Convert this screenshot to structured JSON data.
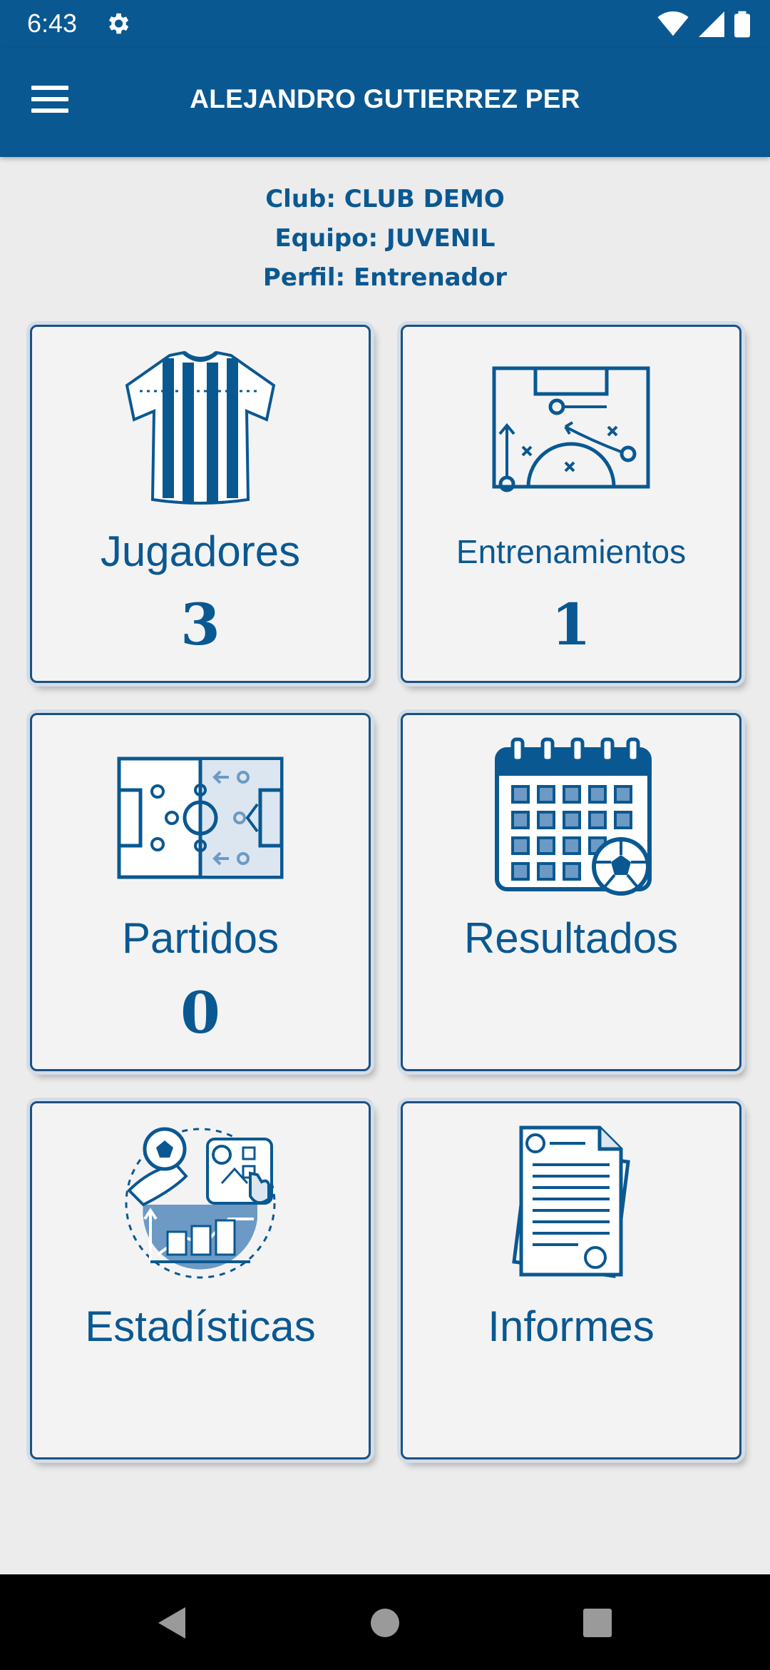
{
  "status_bar": {
    "time": "6:43"
  },
  "app_bar": {
    "title": "ALEJANDRO GUTIERREZ PER"
  },
  "info": {
    "club": "Club: CLUB DEMO",
    "team": "Equipo: JUVENIL",
    "profile": "Perfil: Entrenador"
  },
  "tiles": [
    {
      "label": "Jugadores",
      "count": "3",
      "icon": "jersey-icon"
    },
    {
      "label": "Entrenamientos",
      "count": "1",
      "icon": "tactics-board-icon"
    },
    {
      "label": "Partidos",
      "count": "0",
      "icon": "soccer-field-icon"
    },
    {
      "label": "Resultados",
      "count": "",
      "icon": "calendar-ball-icon"
    },
    {
      "label": "Estadísticas",
      "count": "",
      "icon": "statistics-icon"
    },
    {
      "label": "Informes",
      "count": "",
      "icon": "report-documents-icon"
    }
  ],
  "colors": {
    "primary": "#0a5891",
    "tile_bg": "#f3f3f4",
    "page_bg": "#ececec"
  }
}
